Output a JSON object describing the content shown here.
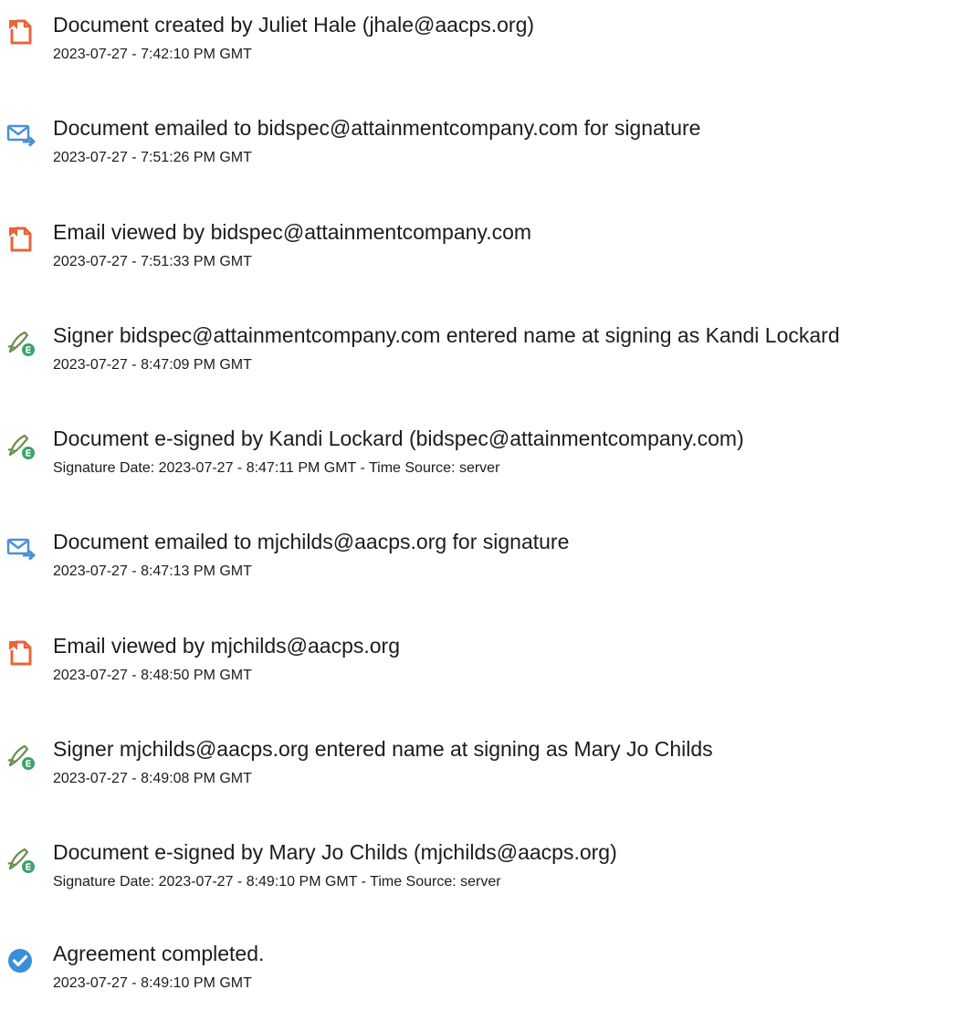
{
  "events": [
    {
      "icon": "document-created-icon",
      "title": "Document created by Juliet Hale (jhale@aacps.org)",
      "detail": "2023-07-27 - 7:42:10 PM GMT"
    },
    {
      "icon": "email-sent-icon",
      "title": "Document emailed to bidspec@attainmentcompany.com for signature",
      "detail": "2023-07-27 - 7:51:26 PM GMT"
    },
    {
      "icon": "document-viewed-icon",
      "title": "Email viewed by bidspec@attainmentcompany.com",
      "detail": "2023-07-27 - 7:51:33 PM GMT"
    },
    {
      "icon": "signature-pen-icon",
      "title": "Signer bidspec@attainmentcompany.com entered name at signing as Kandi Lockard",
      "detail": "2023-07-27 - 8:47:09 PM GMT"
    },
    {
      "icon": "signature-pen-icon",
      "title": "Document e-signed by Kandi Lockard (bidspec@attainmentcompany.com)",
      "detail": "Signature Date: 2023-07-27 - 8:47:11 PM GMT - Time Source: server"
    },
    {
      "icon": "email-sent-icon",
      "title": "Document emailed to mjchilds@aacps.org for signature",
      "detail": "2023-07-27 - 8:47:13 PM GMT"
    },
    {
      "icon": "document-viewed-icon",
      "title": "Email viewed by mjchilds@aacps.org",
      "detail": "2023-07-27 - 8:48:50 PM GMT"
    },
    {
      "icon": "signature-pen-icon",
      "title": "Signer mjchilds@aacps.org entered name at signing as Mary Jo Childs",
      "detail": "2023-07-27 - 8:49:08 PM GMT"
    },
    {
      "icon": "signature-pen-icon",
      "title": "Document e-signed by Mary Jo Childs (mjchilds@aacps.org)",
      "detail": "Signature Date: 2023-07-27 - 8:49:10 PM GMT - Time Source: server"
    },
    {
      "icon": "check-circle-icon",
      "title": "Agreement completed.",
      "detail": "2023-07-27 - 8:49:10 PM GMT"
    }
  ],
  "colors": {
    "doc_orange": "#e8643a",
    "mail_blue": "#4a90d9",
    "pen_green": "#3aa36a",
    "check_blue": "#3a8fd8"
  }
}
